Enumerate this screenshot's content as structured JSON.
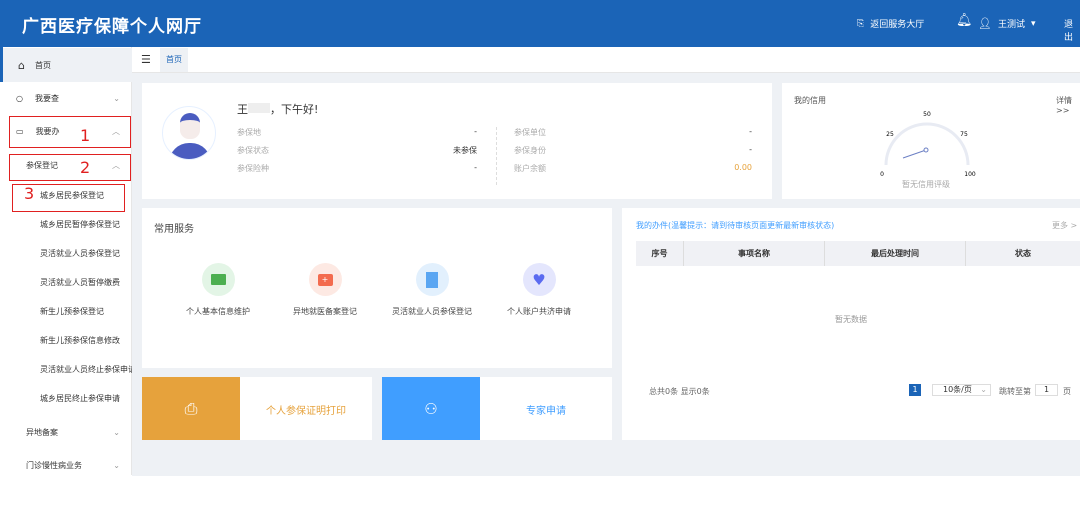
{
  "header": {
    "title": "广西医疗保障个人网厅",
    "return_label": "返回服务大厅",
    "user_name": "王测试",
    "logout_label": "退出"
  },
  "breadcrumb": {
    "current": "首页"
  },
  "sidebar": {
    "home": "首页",
    "query": "我要查",
    "handle": "我要办",
    "reg_group": "参保登记",
    "sub_items": [
      "城乡居民参保登记",
      "城乡居民暂停参保登记",
      "灵活就业人员参保登记",
      "灵活就业人员暂停缴费",
      "新生儿预参保登记",
      "新生儿预参保信息修改",
      "灵活就业人员终止参保申请",
      "城乡居民终止参保申请"
    ],
    "remote": "异地备案",
    "outpatient": "门诊慢性病业务"
  },
  "annotations": [
    "1",
    "2",
    "3"
  ],
  "profile": {
    "greeting_name": "王",
    "greeting": "，下午好!",
    "left": [
      {
        "label": "参保地",
        "value": "-"
      },
      {
        "label": "参保状态",
        "value": "未参保"
      },
      {
        "label": "参保险种",
        "value": "-"
      }
    ],
    "right": [
      {
        "label": "参保单位",
        "value": "-"
      },
      {
        "label": "参保身份",
        "value": "-"
      },
      {
        "label": "账户余额",
        "value": "0.00"
      }
    ]
  },
  "credit": {
    "title": "我的信用",
    "detail": "详情>>",
    "ticks": [
      "0",
      "25",
      "50",
      "75",
      "100"
    ],
    "status": "暂无信用评级",
    "value": 0
  },
  "services": {
    "title": "常用服务",
    "items": [
      "个人基本信息维护",
      "异地就医备案登记",
      "灵活就业人员参保登记",
      "个人账户共济申请"
    ]
  },
  "actions": {
    "print": "个人参保证明打印",
    "expert": "专家申请"
  },
  "todo": {
    "title": "我的办件(温馨提示：请到待审核页面更新最新审核状态)",
    "more": "更多 >",
    "columns": [
      "序号",
      "事项名称",
      "最后处理时间",
      "状态"
    ],
    "empty": "暂无数据",
    "total": "总共0条 显示0条",
    "page": "1",
    "page_size": "10条/页",
    "jump_label": "跳转至第",
    "jump_value": "1",
    "page_unit": "页"
  },
  "colors": {
    "primary": "#1b64b7",
    "orange": "#e6a23c",
    "blue": "#409eff",
    "red": "#e02020"
  }
}
